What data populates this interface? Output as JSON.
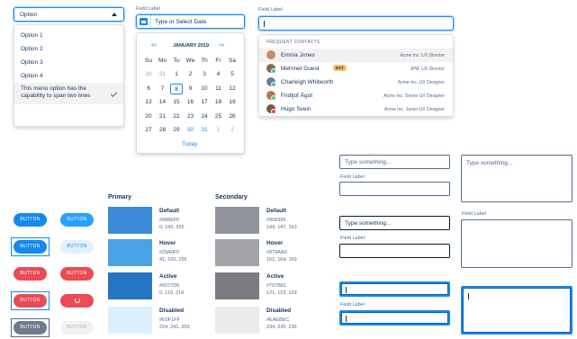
{
  "dropdown": {
    "value": "Option",
    "options": [
      "Option 1",
      "Option 2",
      "Option 3",
      "Option 4"
    ],
    "selected_option": "This menu option has the capability to span two lines"
  },
  "datepicker": {
    "label": "Field Label",
    "placeholder": "Type or Select Date",
    "month": "JANUARY 2019",
    "prev": "«  ‹",
    "next": "›  »",
    "weekdays": [
      "Su",
      "Mo",
      "Tu",
      "We",
      "Th",
      "Fr",
      "Sa"
    ],
    "weeks": [
      [
        "30",
        "31",
        "1",
        "2",
        "3",
        "4",
        "5"
      ],
      [
        "6",
        "7",
        "8",
        "9",
        "10",
        "11",
        "12"
      ],
      [
        "13",
        "14",
        "15",
        "16",
        "17",
        "18",
        "19"
      ],
      [
        "20",
        "21",
        "22",
        "23",
        "24",
        "25",
        "26"
      ],
      [
        "27",
        "28",
        "29",
        "30",
        "31",
        "1",
        "2"
      ]
    ],
    "today_label": "Today"
  },
  "lookup": {
    "label": "Field Label",
    "value": "|",
    "section_title": "FREQUENT CONTACTS",
    "contacts": [
      {
        "name": "Emma Jones",
        "title": "Acme Inc. UX Director",
        "badge": ""
      },
      {
        "name": "Mehmet Guest",
        "title": "JPM, UX Director",
        "badge": "EXT"
      },
      {
        "name": "Charleigh Whitworth",
        "title": "Acme Inc. UX Designer",
        "badge": ""
      },
      {
        "name": "Fridtjof Ågot",
        "title": "Acme Inc. Senior UX Designer",
        "badge": ""
      },
      {
        "name": "Hugo Svein",
        "title": "Acme Inc. Junior UX Designer",
        "badge": ""
      }
    ]
  },
  "buttons": {
    "label": "BUTTON"
  },
  "swatches": {
    "primary_header": "Primary",
    "secondary_header": "Secondary",
    "primary": [
      {
        "name": "Default",
        "hex": "#008EFF",
        "rgb": "0, 142, 255",
        "color": "#3b8bd9"
      },
      {
        "name": "Hover",
        "hex": "#29A0FF",
        "rgb": "41, 160, 255",
        "color": "#4aa3e6"
      },
      {
        "name": "Active",
        "hex": "#0077D6",
        "rgb": "0, 119, 214",
        "color": "#2575c4"
      },
      {
        "name": "Disabled",
        "hex": "#E0F1FF",
        "rgb": "224, 241, 255",
        "color": "#dcefff"
      }
    ],
    "secondary": [
      {
        "name": "Default",
        "hex": "#909399",
        "rgb": "144, 147, 153",
        "color": "#909399"
      },
      {
        "name": "Hover",
        "hex": "#979AA0",
        "rgb": "162, 164, 169",
        "color": "#a2a4a9"
      },
      {
        "name": "Active",
        "hex": "#797B81",
        "rgb": "121, 123, 129",
        "color": "#797b81"
      },
      {
        "name": "Disabled",
        "hex": "#EAEBEC",
        "rgb": "234, 235, 236",
        "color": "#eaebec"
      }
    ]
  },
  "inputs": {
    "placeholder": "Type something...",
    "field_label": "Field Label",
    "focused_value": "|"
  },
  "colors": {
    "brand": "#1589ee",
    "danger": "#ea4b54",
    "text": "#16325c"
  }
}
